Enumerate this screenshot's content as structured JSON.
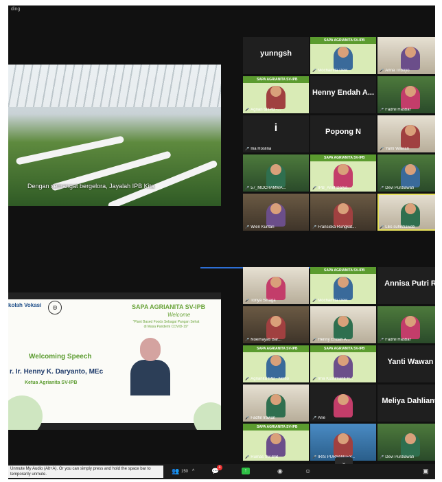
{
  "window": {
    "top_label": "ding"
  },
  "top_share": {
    "caption": "Dengan semangat bergelora, Jayalah IPB Kita"
  },
  "bottom_slide": {
    "logo_text": "kolah Vokasi",
    "brand": "SAPA AGRIANITA SV-IPB",
    "welcome_script": "Welcome",
    "theme": "\"Plant Based Foods Sebagai Pangan Sehat di Masa Pandemi COVID-19\"",
    "speech_title": "Welcoming Speech",
    "speaker": "r. Ir. Henny K. Daryanto, MEc",
    "role": "Ketua Agrianita SV-IPB"
  },
  "top_gallery": [
    {
      "name": "",
      "big": "yunngsh",
      "style": "dark"
    },
    {
      "name": "Mochamita Dew...",
      "style": "agr"
    },
    {
      "name": "Anna Triboyo",
      "style": "light"
    },
    {
      "name": "Agrian ta IPB -...",
      "style": "agr"
    },
    {
      "name": "",
      "big": "Henny Endah A...",
      "style": "dark"
    },
    {
      "name": "Fadhil Hasbar",
      "style": "outdoor"
    },
    {
      "name": "Ina Roslina",
      "big": "i",
      "style": "dark"
    },
    {
      "name": "",
      "big": "Popong N",
      "style": "dark"
    },
    {
      "name": "Yanti Wawan",
      "style": "light"
    },
    {
      "name": "57_MOCHAMMA...",
      "style": "outdoor"
    },
    {
      "name": "IPB_Arief Darya...",
      "style": "agr"
    },
    {
      "name": "Devi Purdiawati",
      "style": "outdoor"
    },
    {
      "name": "Wien Kuntari",
      "style": "room"
    },
    {
      "name": "Fransiska Rungkat...",
      "style": "room"
    },
    {
      "name": "Lilis suhistiawati",
      "style": "light"
    }
  ],
  "bottom_gallery": [
    {
      "name": "Tonya Sinaga",
      "style": "light"
    },
    {
      "name": "Mochamita Dew...",
      "style": "agr"
    },
    {
      "name": "",
      "big": "Annisa Putri R",
      "style": "dark"
    },
    {
      "name": "Noerhayati Bar...",
      "style": "room"
    },
    {
      "name": "Henny Endah A...",
      "style": "light"
    },
    {
      "name": "Fadhil Hasbar",
      "style": "outdoor"
    },
    {
      "name": "Agrianita IPB - Nelso",
      "style": "agr"
    },
    {
      "name": "Irna Kusumanti H...",
      "style": "agr"
    },
    {
      "name": "",
      "big": "Yanti Wawan",
      "style": "dark"
    },
    {
      "name": "Fadhil Irawan",
      "style": "light"
    },
    {
      "name": "Arie",
      "style": "dark"
    },
    {
      "name": "",
      "big": "Meliya Dahlianti",
      "style": "dark"
    },
    {
      "name": "Humas SV-IPB",
      "style": "agr"
    },
    {
      "name": "IRIS PURYANTEY...",
      "style": "sea"
    },
    {
      "name": "Devi Purdiawati",
      "style": "outdoor"
    }
  ],
  "toolbar": {
    "hint": "Unmute My Audio (Alt+A). Or you can simply press and hold the space bar to temporarily unmute.",
    "participants_count": "150",
    "chat_badge": "4",
    "chevron": "⌄"
  }
}
